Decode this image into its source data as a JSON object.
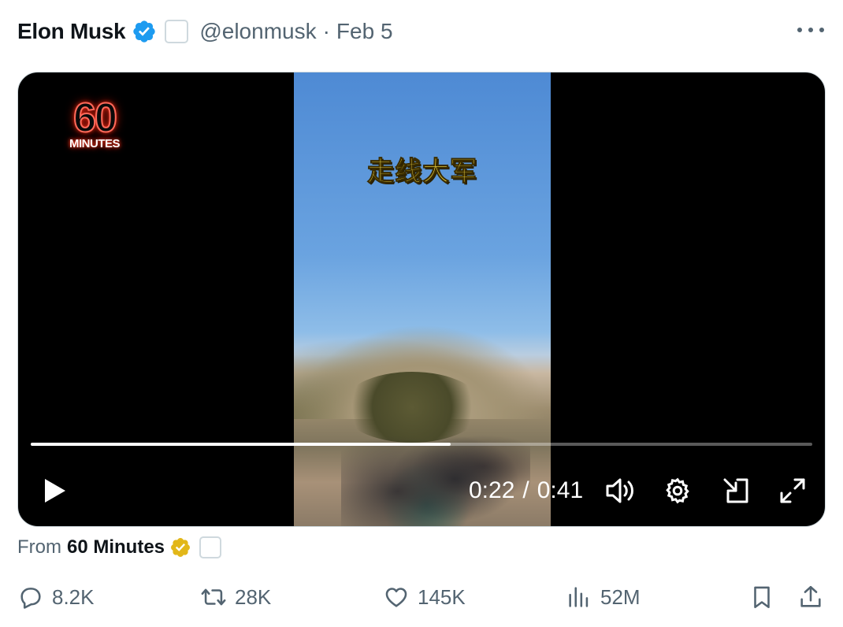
{
  "tweet": {
    "author_name": "Elon Musk",
    "handle": "@elonmusk",
    "separator": "·",
    "date": "Feb 5"
  },
  "video": {
    "logo_number": "60",
    "logo_word": "MINUTES",
    "caption": "走线大军",
    "current_time": "0:22",
    "time_separator": "/",
    "duration": "0:41",
    "progress_fraction": 0.537
  },
  "from": {
    "prefix": "From",
    "source": "60 Minutes"
  },
  "actions": {
    "replies": "8.2K",
    "reposts": "28K",
    "likes": "145K",
    "views": "52M"
  },
  "colors": {
    "verified_blue": "#1d9bf0",
    "verified_gold": "#e2b719",
    "secondary_text": "#536471"
  }
}
